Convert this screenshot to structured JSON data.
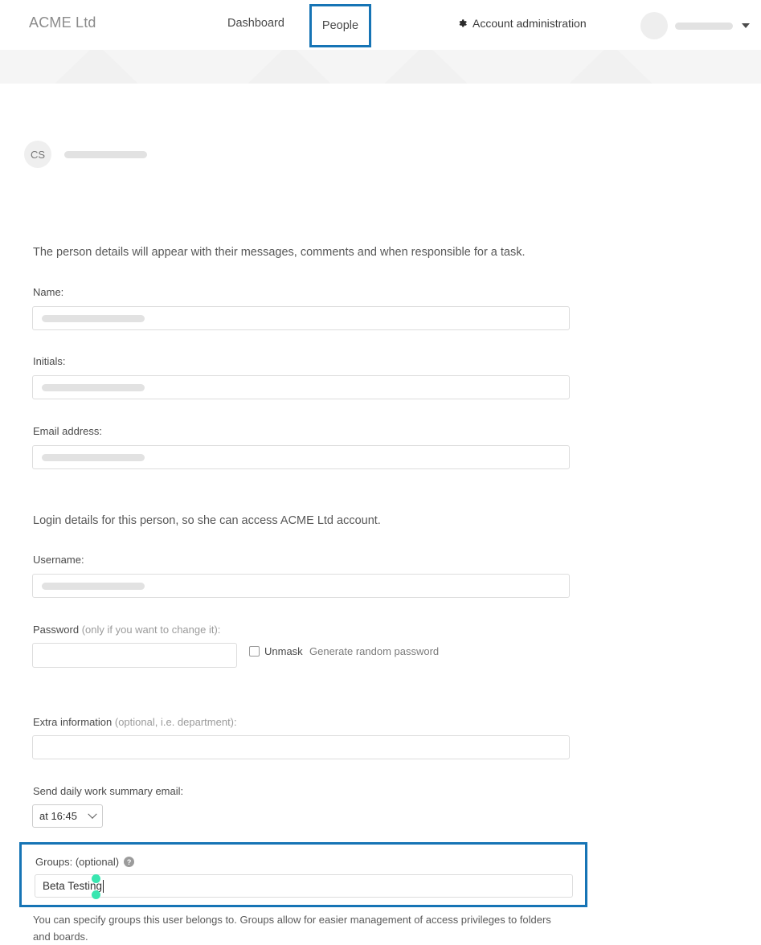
{
  "header": {
    "brand": "ACME Ltd",
    "nav": [
      {
        "label": "Dashboard",
        "name": "nav-dashboard"
      },
      {
        "label": "People",
        "name": "nav-people",
        "highlighted": true
      }
    ],
    "account_admin_label": "Account administration",
    "gear_icon": "gear-icon",
    "user_menu": {
      "avatar_icon": "avatar",
      "name_redacted": true,
      "caret_icon": "chevron-down-icon"
    },
    "highlight_color": "#1674b5"
  },
  "person": {
    "avatar_initials": "CS",
    "name_redacted": true
  },
  "main": {
    "intro_text": "The person details will appear with their messages, comments and when responsible for a task.",
    "login_text": "Login details for this person, so she can access ACME Ltd account.",
    "fields": {
      "name": {
        "label": "Name:",
        "value": "",
        "redacted": true
      },
      "initials": {
        "label": "Initials:",
        "value": "",
        "redacted": true
      },
      "email": {
        "label": "Email address:",
        "value": "",
        "redacted": true
      },
      "username": {
        "label": "Username:",
        "value": "",
        "redacted": true
      },
      "password": {
        "label_main": "Password",
        "label_note": " (only if you want to change it):",
        "value": "",
        "unmask_label": "Unmask",
        "unmask_checked": false,
        "generate_label": "Generate random password"
      },
      "extra_information": {
        "label_main": "Extra information",
        "label_note": " (optional, i.e. department):",
        "value": ""
      },
      "summary_email": {
        "label": "Send daily work summary email:",
        "selected": "at 16:45"
      },
      "groups": {
        "label": "Groups: (optional)",
        "help_icon": "help-icon",
        "help_glyph": "?",
        "value": "Beta Testing",
        "focused": true,
        "help_text": "You can specify groups this user belongs to. Groups allow for easier management of access privileges to folders and boards.",
        "selection_handle_color": "#39e6b0"
      }
    }
  }
}
